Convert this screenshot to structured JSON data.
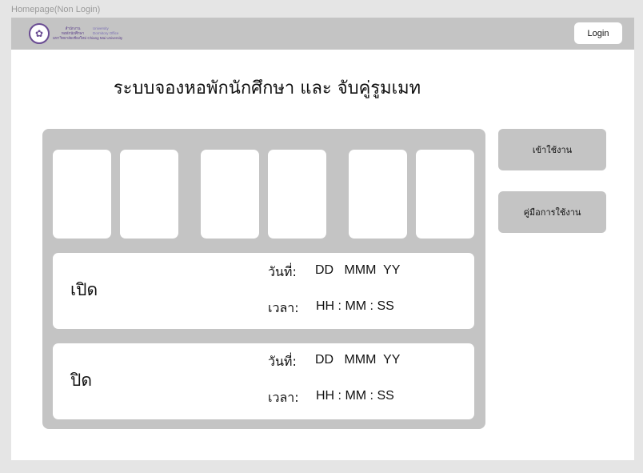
{
  "frame_label": "Homepage(Non Login)",
  "header": {
    "logo": {
      "th_line1": "สำนักงาน",
      "en_line1": "University",
      "th_line2": "หอพักนักศึกษา",
      "en_line2": "Dormitory Office",
      "university": "มหาวิทยาลัยเชียงใหม่ Chiang Mai University"
    },
    "login_label": "Login"
  },
  "main": {
    "title": "ระบบจองหอพักนักศึกษา และ จับคู่รูมเมท"
  },
  "status": {
    "open": {
      "label": "เปิด",
      "date_label": "วันที่:",
      "date_value": "DD   MMM  YY",
      "time_label": "เวลา:",
      "time_value": "HH : MM : SS"
    },
    "close": {
      "label": "ปิด",
      "date_label": "วันที่:",
      "date_value": "DD   MMM  YY",
      "time_label": "เวลา:",
      "time_value": "HH : MM : SS"
    }
  },
  "sidebar": {
    "enter_label": "เข้าใช้งาน",
    "manual_label": "คู่มือการใช้งาน"
  },
  "colors": {
    "background": "#e5e5e5",
    "panel": "#c4c4c4",
    "card": "#ffffff",
    "logo_purple": "#6a4c93"
  }
}
